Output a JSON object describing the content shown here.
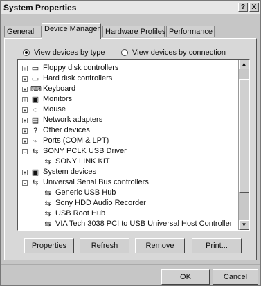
{
  "window": {
    "title": "System Properties",
    "help_label": "?",
    "close_label": "X"
  },
  "tabs": [
    {
      "label": "General"
    },
    {
      "label": "Device Manager"
    },
    {
      "label": "Hardware Profiles"
    },
    {
      "label": "Performance"
    }
  ],
  "view": {
    "by_type_label": "View devices by type",
    "by_connection_label": "View devices by connection",
    "selected": "by_type"
  },
  "devices": [
    {
      "label": "Floppy disk controllers",
      "level": 0,
      "expander": "+",
      "icon": "floppy-icon"
    },
    {
      "label": "Hard disk controllers",
      "level": 0,
      "expander": "+",
      "icon": "hard-disk-icon"
    },
    {
      "label": "Keyboard",
      "level": 0,
      "expander": "+",
      "icon": "keyboard-icon"
    },
    {
      "label": "Monitors",
      "level": 0,
      "expander": "+",
      "icon": "monitor-icon"
    },
    {
      "label": "Mouse",
      "level": 0,
      "expander": "+",
      "icon": "mouse-icon"
    },
    {
      "label": "Network adapters",
      "level": 0,
      "expander": "+",
      "icon": "network-icon"
    },
    {
      "label": "Other devices",
      "level": 0,
      "expander": "+",
      "icon": "question-icon"
    },
    {
      "label": "Ports (COM & LPT)",
      "level": 0,
      "expander": "+",
      "icon": "port-icon"
    },
    {
      "label": "SONY PCLK USB Driver",
      "level": 0,
      "expander": "-",
      "icon": "usb-icon"
    },
    {
      "label": "SONY LINK KIT",
      "level": 1,
      "expander": "",
      "icon": "usb-icon"
    },
    {
      "label": "System devices",
      "level": 0,
      "expander": "+",
      "icon": "computer-icon"
    },
    {
      "label": "Universal Serial Bus controllers",
      "level": 0,
      "expander": "-",
      "icon": "usb-icon"
    },
    {
      "label": "Generic USB Hub",
      "level": 1,
      "expander": "",
      "icon": "usb-icon"
    },
    {
      "label": "Sony HDD Audio Recorder",
      "level": 1,
      "expander": "",
      "icon": "usb-icon"
    },
    {
      "label": "USB Root Hub",
      "level": 1,
      "expander": "",
      "icon": "usb-icon"
    },
    {
      "label": "VIA Tech 3038 PCI to USB Universal Host Controller",
      "level": 1,
      "expander": "",
      "icon": "usb-icon"
    }
  ],
  "buttons": {
    "properties": "Properties",
    "refresh": "Refresh",
    "remove": "Remove",
    "print": "Print...",
    "ok": "OK",
    "cancel": "Cancel"
  }
}
